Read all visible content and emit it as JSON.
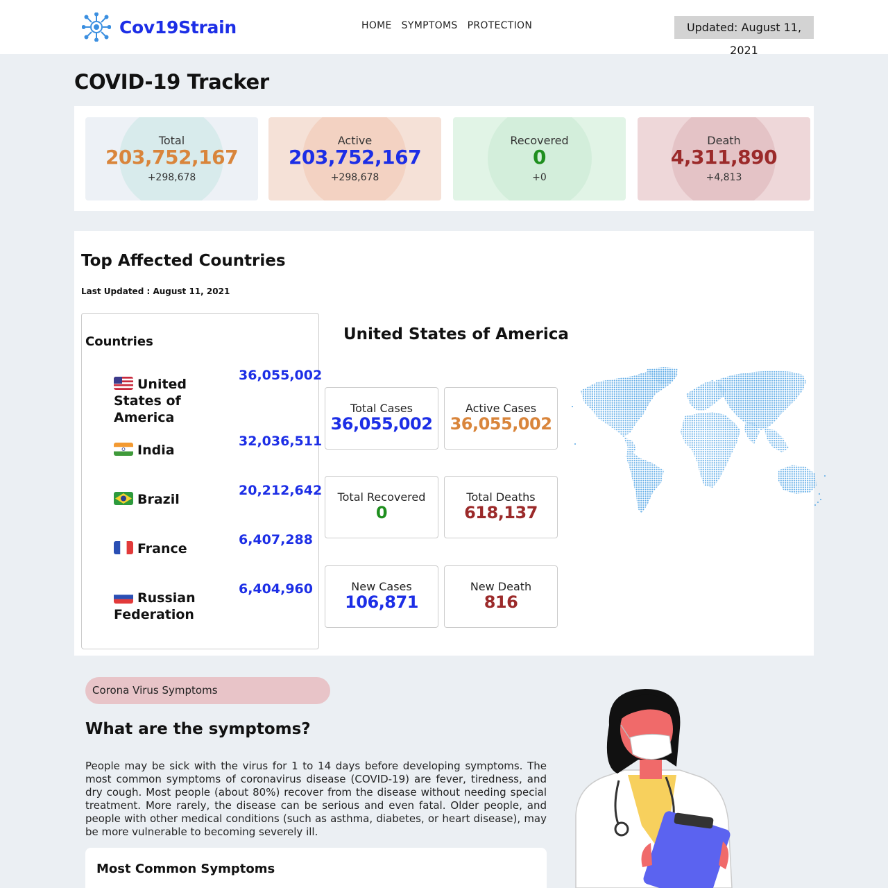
{
  "brand": {
    "name": "Cov19Strain",
    "logo_icon": "virus-icon"
  },
  "nav": {
    "items": [
      "HOME",
      "SYMPTOMS",
      "PROTECTION"
    ]
  },
  "header": {
    "updated": "Updated: August 11, 2021"
  },
  "page_title": "COVID-19 Tracker",
  "stats": [
    {
      "label": "Total",
      "value": "203,752,167",
      "delta": "+298,678",
      "value_color": "#d9853b",
      "card_bg": "#edf1f6",
      "circle_bg": "#d8ebec"
    },
    {
      "label": "Active",
      "value": "203,752,167",
      "delta": "+298,678",
      "value_color": "#1c2ee6",
      "card_bg": "#f5e1d7",
      "circle_bg": "#f3d2c2"
    },
    {
      "label": "Recovered",
      "value": "0",
      "delta": "+0",
      "value_color": "#1f8f1f",
      "card_bg": "#e1f4e6",
      "circle_bg": "#d3eedb"
    },
    {
      "label": "Death",
      "value": "4,311,890",
      "delta": "+4,813",
      "value_color": "#9b2a2a",
      "card_bg": "#eed7d9",
      "circle_bg": "#e4c3c6"
    }
  ],
  "top_affected": {
    "title": "Top Affected Countries",
    "last_updated": "Last Updated : August 11, 2021",
    "countries_heading": "Countries",
    "countries": [
      {
        "name": "United States of America",
        "count": "36,055,002",
        "flag": "us-flag-icon"
      },
      {
        "name": "India",
        "count": "32,036,511",
        "flag": "india-flag-icon"
      },
      {
        "name": "Brazil",
        "count": "20,212,642",
        "flag": "brazil-flag-icon"
      },
      {
        "name": "France",
        "count": "6,407,288",
        "flag": "france-flag-icon"
      },
      {
        "name": "Russian Federation",
        "count": "6,404,960",
        "flag": "russia-flag-icon"
      }
    ],
    "selected_country": "United States of America",
    "details": [
      {
        "label": "Total Cases",
        "value": "36,055,002",
        "color": "#1c2ee6"
      },
      {
        "label": "Active Cases",
        "value": "36,055,002",
        "color": "#d9853b"
      },
      {
        "label": "Total Recovered",
        "value": "0",
        "color": "#1f8f1f"
      },
      {
        "label": "Total Deaths",
        "value": "618,137",
        "color": "#9b2a2a"
      },
      {
        "label": "New Cases",
        "value": "106,871",
        "color": "#1c2ee6"
      },
      {
        "label": "New Death",
        "value": "816",
        "color": "#9b2a2a"
      }
    ],
    "map_icon": "world-map-icon",
    "map_color": "#5aa9e6"
  },
  "symptoms": {
    "pill": "Corona Virus Symptoms",
    "heading": "What are the symptoms?",
    "text": "People may be sick with the virus for 1 to 14 days before developing symptoms. The most common symptoms of coronavirus disease (COVID-19) are fever, tiredness, and dry cough. Most people (about 80%) recover from the disease without needing special treatment. More rarely, the disease can be serious and even fatal. Older people, and people with other medical conditions (such as asthma, diabetes, or heart disease), may be more vulnerable to becoming severely ill.",
    "common_title": "Most Common Symptoms",
    "illustration": "doctor-illustration"
  }
}
